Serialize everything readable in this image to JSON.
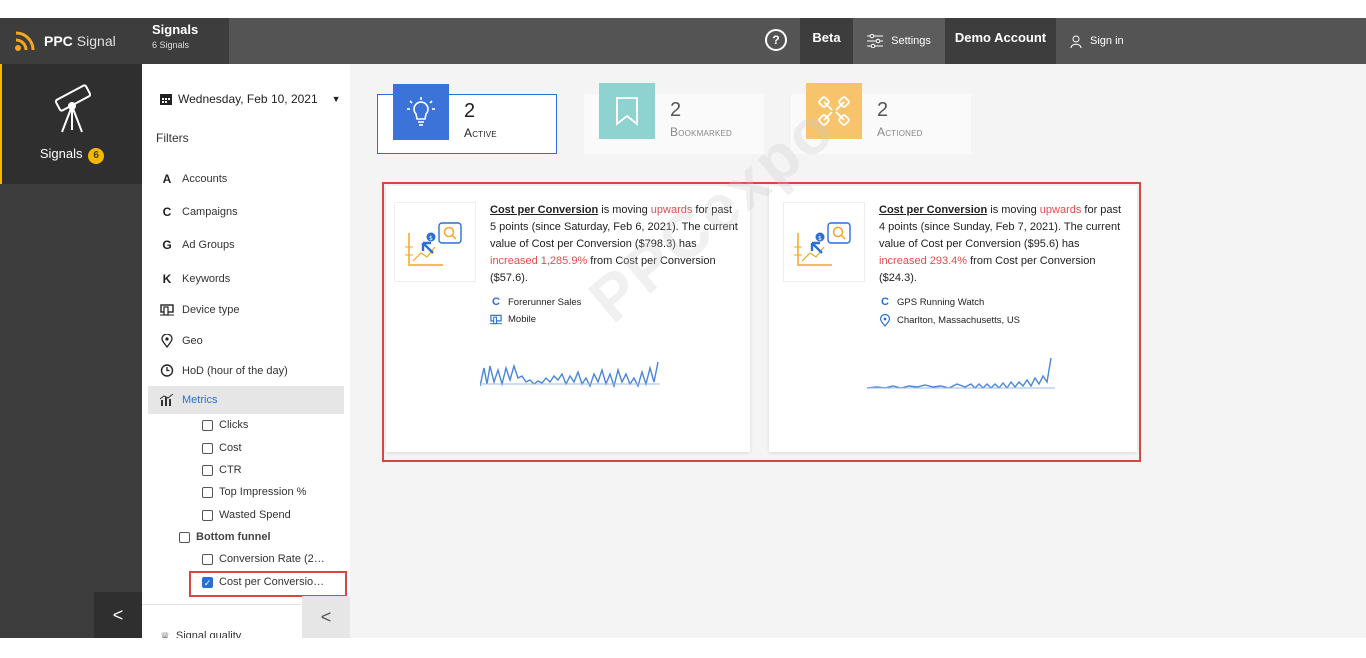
{
  "header": {
    "brand_bold": "PPC",
    "brand_light": "Signal",
    "tab_title": "Signals",
    "tab_subtitle": "6 Signals",
    "help_label": "?",
    "beta_label": "Beta",
    "settings_label": "Settings",
    "account_label": "Demo Account",
    "signin_label": "Sign in"
  },
  "rail": {
    "signals_label": "Signals",
    "signals_count": "6",
    "collapse_label": "<"
  },
  "filters": {
    "date": "Wednesday, Feb 10, 2021",
    "title": "Filters",
    "items": [
      {
        "icon": "A",
        "label": "Accounts"
      },
      {
        "icon": "C",
        "label": "Campaigns"
      },
      {
        "icon": "G",
        "label": "Ad Groups"
      },
      {
        "icon": "K",
        "label": "Keywords"
      },
      {
        "icon": "device",
        "label": "Device type"
      },
      {
        "icon": "pin",
        "label": "Geo"
      },
      {
        "icon": "clock",
        "label": "HoD (hour of the day)"
      }
    ],
    "metrics_label": "Metrics",
    "metric_options": [
      {
        "label": "Clicks",
        "checked": false
      },
      {
        "label": "Cost",
        "checked": false
      },
      {
        "label": "CTR",
        "checked": false
      },
      {
        "label": "Top Impression %",
        "checked": false
      },
      {
        "label": "Wasted Spend",
        "checked": false
      }
    ],
    "bottom_funnel_label": "Bottom funnel",
    "funnel_options": [
      {
        "label": "Conversion Rate (2…",
        "checked": false
      },
      {
        "label": "Cost per Conversio…",
        "checked": true
      }
    ],
    "signal_quality_label": "Signal quality",
    "collapse_label": "<"
  },
  "summary": [
    {
      "count": "2",
      "label": "Active",
      "color": "#3b73d9"
    },
    {
      "count": "2",
      "label": "Bookmarked",
      "color": "#8fd3d0"
    },
    {
      "count": "2",
      "label": "Actioned",
      "color": "#f7c46c"
    }
  ],
  "cards": [
    {
      "metric": "Cost per Conversion",
      "t1": " is moving ",
      "direction": "upwards",
      "t2": " for past 5 points (since Saturday, Feb 6, 2021). The current value of Cost per Conversion ($798.3) has ",
      "change": "increased 1,285.9%",
      "t3": " from Cost per Conversion ($57.6).",
      "campaign": "Forerunner Sales",
      "dimension": "Mobile",
      "dimension_icon": "device"
    },
    {
      "metric": "Cost per Conversion",
      "t1": " is moving ",
      "direction": "upwards",
      "t2": " for past 4 points (since Sunday, Feb 7, 2021). The current value of Cost per Conversion ($95.6) has ",
      "change": "increased 293.4%",
      "t3": " from Cost per Conversion ($24.3).",
      "campaign": "GPS Running Watch",
      "dimension": "Charlton, Massachusetts, US",
      "dimension_icon": "pin"
    }
  ],
  "watermark": "PPCexpo",
  "colors": {
    "accent": "#2a6fd6",
    "highlight": "#d9453f",
    "badge": "#f5b800",
    "up": "#e24b4b"
  }
}
